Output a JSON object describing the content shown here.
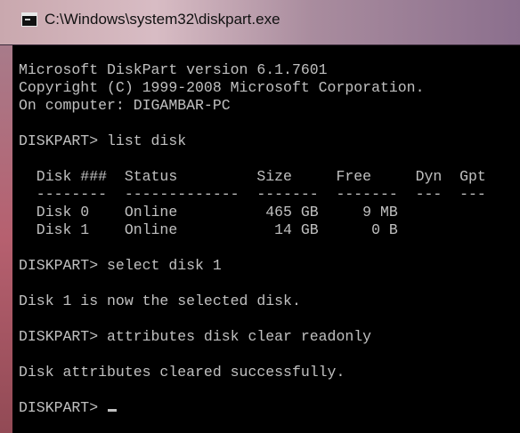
{
  "window": {
    "title": "C:\\Windows\\system32\\diskpart.exe",
    "icon": "console-icon"
  },
  "console": {
    "lines": [
      "Microsoft DiskPart version 6.1.7601",
      "Copyright (C) 1999-2008 Microsoft Corporation.",
      "On computer: DIGAMBAR-PC",
      "",
      "DISKPART> list disk",
      "",
      "  Disk ###  Status         Size     Free     Dyn  Gpt",
      "  --------  -------------  -------  -------  ---  ---",
      "  Disk 0    Online          465 GB     9 MB",
      "  Disk 1    Online           14 GB      0 B",
      "",
      "DISKPART> select disk 1",
      "",
      "Disk 1 is now the selected disk.",
      "",
      "DISKPART> attributes disk clear readonly",
      "",
      "Disk attributes cleared successfully.",
      ""
    ],
    "prompt": "DISKPART> "
  },
  "colors": {
    "console_bg": "#000000",
    "console_text": "#c0c0c0"
  }
}
